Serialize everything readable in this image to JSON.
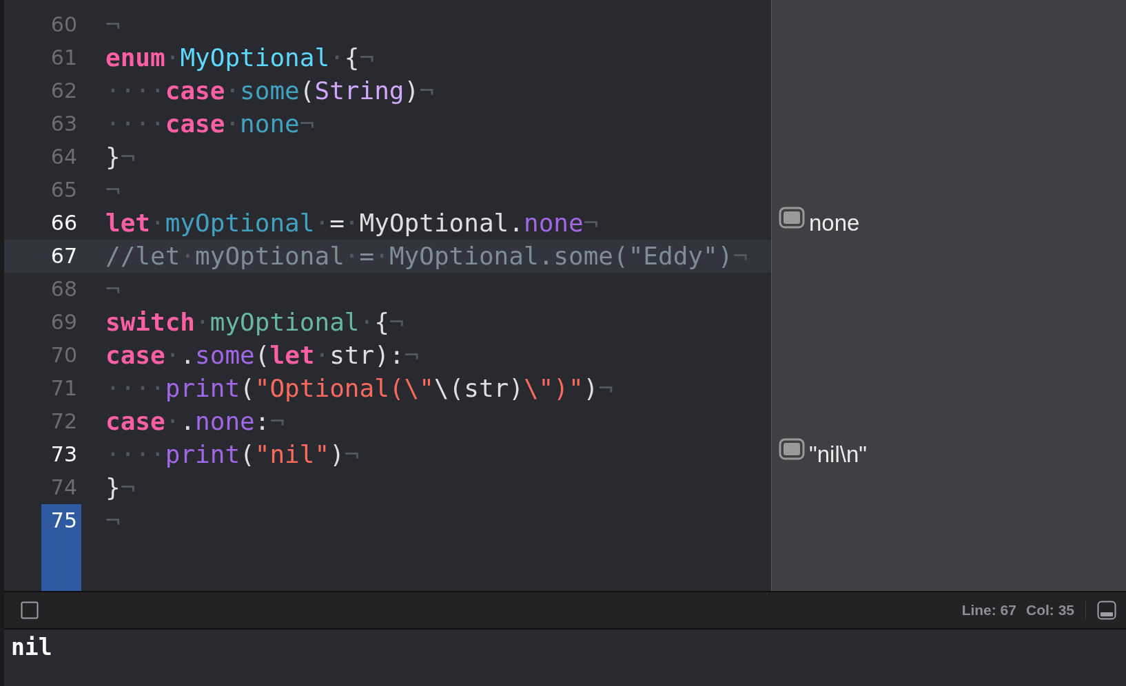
{
  "editor": {
    "lines": [
      {
        "number": "60",
        "current": false,
        "marker": false,
        "tokens": [
          {
            "kind": "invisible",
            "text": "¬"
          }
        ]
      },
      {
        "number": "61",
        "current": false,
        "marker": false,
        "tokens": [
          {
            "kind": "keyword",
            "text": "enum"
          },
          {
            "kind": "invisible",
            "text": "·"
          },
          {
            "kind": "decl-type",
            "text": "MyOptional"
          },
          {
            "kind": "invisible",
            "text": "·"
          },
          {
            "kind": "plain",
            "text": "{"
          },
          {
            "kind": "invisible",
            "text": "¬"
          }
        ]
      },
      {
        "number": "62",
        "current": false,
        "marker": false,
        "tokens": [
          {
            "kind": "invisible",
            "text": "····"
          },
          {
            "kind": "keyword",
            "text": "case"
          },
          {
            "kind": "invisible",
            "text": "·"
          },
          {
            "kind": "decl-other",
            "text": "some"
          },
          {
            "kind": "plain",
            "text": "("
          },
          {
            "kind": "type",
            "text": "String"
          },
          {
            "kind": "plain",
            "text": ")"
          },
          {
            "kind": "invisible",
            "text": "¬"
          }
        ]
      },
      {
        "number": "63",
        "current": false,
        "marker": false,
        "tokens": [
          {
            "kind": "invisible",
            "text": "····"
          },
          {
            "kind": "keyword",
            "text": "case"
          },
          {
            "kind": "invisible",
            "text": "·"
          },
          {
            "kind": "decl-other",
            "text": "none"
          },
          {
            "kind": "invisible",
            "text": "¬"
          }
        ]
      },
      {
        "number": "64",
        "current": false,
        "marker": false,
        "tokens": [
          {
            "kind": "plain",
            "text": "}"
          },
          {
            "kind": "invisible",
            "text": "¬"
          }
        ]
      },
      {
        "number": "65",
        "current": false,
        "marker": false,
        "tokens": [
          {
            "kind": "invisible",
            "text": "¬"
          }
        ]
      },
      {
        "number": "66",
        "current": false,
        "marker": false,
        "result": "none",
        "tokens": [
          {
            "kind": "keyword",
            "text": "let"
          },
          {
            "kind": "invisible",
            "text": "·"
          },
          {
            "kind": "decl-other",
            "text": "myOptional"
          },
          {
            "kind": "invisible",
            "text": "·"
          },
          {
            "kind": "plain",
            "text": "="
          },
          {
            "kind": "invisible",
            "text": "·"
          },
          {
            "kind": "plain",
            "text": "MyOptional."
          },
          {
            "kind": "member",
            "text": "none"
          },
          {
            "kind": "invisible",
            "text": "¬"
          }
        ]
      },
      {
        "number": "67",
        "current": true,
        "marker": false,
        "tokens": [
          {
            "kind": "comment",
            "text": "//let"
          },
          {
            "kind": "invisible",
            "text": "·"
          },
          {
            "kind": "comment",
            "text": "myOptional"
          },
          {
            "kind": "invisible",
            "text": "·"
          },
          {
            "kind": "comment",
            "text": "="
          },
          {
            "kind": "invisible",
            "text": "·"
          },
          {
            "kind": "comment",
            "text": "MyOptional.some(\"Eddy\")"
          },
          {
            "kind": "invisible",
            "text": "¬"
          }
        ]
      },
      {
        "number": "68",
        "current": false,
        "marker": false,
        "tokens": [
          {
            "kind": "invisible",
            "text": "¬"
          }
        ]
      },
      {
        "number": "69",
        "current": false,
        "marker": false,
        "tokens": [
          {
            "kind": "keyword",
            "text": "switch"
          },
          {
            "kind": "invisible",
            "text": "·"
          },
          {
            "kind": "variable",
            "text": "myOptional"
          },
          {
            "kind": "invisible",
            "text": "·"
          },
          {
            "kind": "plain",
            "text": "{"
          },
          {
            "kind": "invisible",
            "text": "¬"
          }
        ]
      },
      {
        "number": "70",
        "current": false,
        "marker": false,
        "tokens": [
          {
            "kind": "keyword",
            "text": "case"
          },
          {
            "kind": "invisible",
            "text": "·"
          },
          {
            "kind": "plain",
            "text": "."
          },
          {
            "kind": "member",
            "text": "some"
          },
          {
            "kind": "plain",
            "text": "("
          },
          {
            "kind": "keyword",
            "text": "let"
          },
          {
            "kind": "invisible",
            "text": "·"
          },
          {
            "kind": "plain",
            "text": "str):"
          },
          {
            "kind": "invisible",
            "text": "¬"
          }
        ]
      },
      {
        "number": "71",
        "current": false,
        "marker": false,
        "tokens": [
          {
            "kind": "invisible",
            "text": "····"
          },
          {
            "kind": "member",
            "text": "print"
          },
          {
            "kind": "plain",
            "text": "("
          },
          {
            "kind": "string",
            "text": "\"Optional(\\\""
          },
          {
            "kind": "plain",
            "text": "\\(str)"
          },
          {
            "kind": "string",
            "text": "\\\")\""
          },
          {
            "kind": "plain",
            "text": ")"
          },
          {
            "kind": "invisible",
            "text": "¬"
          }
        ]
      },
      {
        "number": "72",
        "current": false,
        "marker": false,
        "tokens": [
          {
            "kind": "keyword",
            "text": "case"
          },
          {
            "kind": "invisible",
            "text": "·"
          },
          {
            "kind": "plain",
            "text": "."
          },
          {
            "kind": "member",
            "text": "none"
          },
          {
            "kind": "plain",
            "text": ":"
          },
          {
            "kind": "invisible",
            "text": "¬"
          }
        ]
      },
      {
        "number": "73",
        "current": false,
        "marker": false,
        "result": "\"nil\\n\"",
        "tokens": [
          {
            "kind": "invisible",
            "text": "····"
          },
          {
            "kind": "member",
            "text": "print"
          },
          {
            "kind": "plain",
            "text": "("
          },
          {
            "kind": "string",
            "text": "\"nil\""
          },
          {
            "kind": "plain",
            "text": ")"
          },
          {
            "kind": "invisible",
            "text": "¬"
          }
        ]
      },
      {
        "number": "74",
        "current": false,
        "marker": false,
        "tokens": [
          {
            "kind": "plain",
            "text": "}"
          },
          {
            "kind": "invisible",
            "text": "¬"
          }
        ]
      },
      {
        "number": "75",
        "current": false,
        "marker": true,
        "tokens": [
          {
            "kind": "invisible",
            "text": "¬"
          }
        ]
      }
    ]
  },
  "status_bar": {
    "line": "Line: 67",
    "column": "Col: 35"
  },
  "console": {
    "output": "nil"
  }
}
